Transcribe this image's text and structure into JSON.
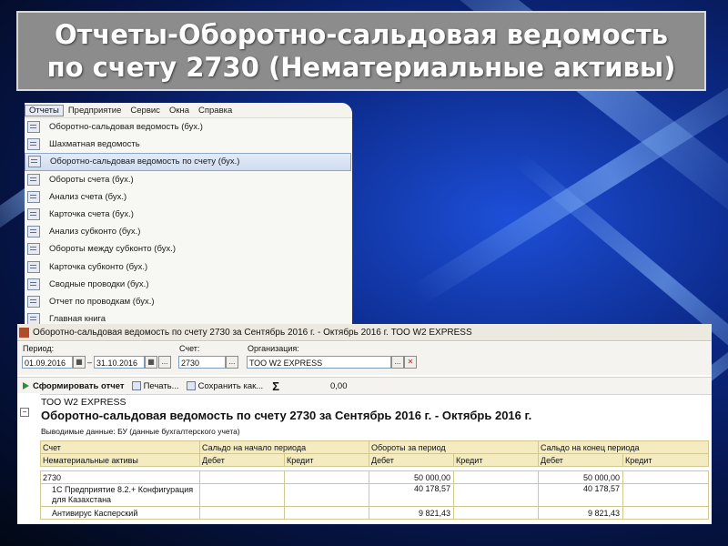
{
  "slide": {
    "title_line1": "Отчеты-Оборотно-сальдовая ведомость",
    "title_line2": "по счету 2730 (Нематериальные активы)"
  },
  "menu": {
    "bar": [
      "Отчеты",
      "Предприятие",
      "Сервис",
      "Окна",
      "Справка"
    ],
    "items": [
      {
        "label": "Оборотно-сальдовая ведомость (бух.)",
        "icon": "report-icon"
      },
      {
        "label": "Шахматная ведомость",
        "icon": "grid-report-icon"
      },
      {
        "label": "Оборотно-сальдовая ведомость по счету (бух.)",
        "icon": "report-icon",
        "selected": true
      },
      {
        "label": "Обороты счета (бух.)",
        "icon": "report-icon"
      },
      {
        "label": "Анализ счета (бух.)",
        "icon": "analysis-icon"
      },
      {
        "label": "Карточка счета (бух.)",
        "icon": "card-icon"
      },
      {
        "label": "Анализ субконто (бух.)",
        "icon": "analysis-icon"
      },
      {
        "label": "Обороты между субконто (бух.)",
        "icon": "report-icon"
      },
      {
        "label": "Карточка субконто (бух.)",
        "icon": "card-icon"
      },
      {
        "label": "Сводные проводки (бух.)",
        "icon": "report-icon"
      },
      {
        "label": "Отчет по проводкам (бух.)",
        "icon": "report-icon"
      },
      {
        "label": "Главная книга",
        "icon": "book-icon"
      }
    ]
  },
  "report": {
    "window_title": "Оборотно-сальдовая ведомость по счету 2730 за Сентябрь 2016 г. - Октябрь 2016 г. ТОО W2 EXPRESS",
    "period_label": "Период:",
    "date_from": "01.09.2016",
    "date_sep": "–",
    "date_to": "31.10.2016",
    "account_label": "Счет:",
    "account_value": "2730",
    "org_label": "Организация:",
    "org_value": "ТОО W2 EXPRESS",
    "ellipsis": "...",
    "clear": "✕",
    "toolbar": {
      "generate": "Сформировать отчет",
      "print": "Печать...",
      "save": "Сохранить как...",
      "sigma": "Σ",
      "sum": "0,00"
    },
    "doc": {
      "org": "ТОО W2 EXPRESS",
      "title": "Оборотно-сальдовая ведомость по счету 2730 за Сентябрь 2016 г. - Октябрь 2016 г.",
      "output": "Выводимые данные:  БУ (данные бухгалтерского учета)",
      "head1": [
        "Счет",
        "Сальдо на начало периода",
        "Обороты за период",
        "Сальдо на конец периода"
      ],
      "head2": [
        "Нематериальные активы",
        "Дебет",
        "Кредит",
        "Дебет",
        "Кредит",
        "Дебет",
        "Кредит"
      ],
      "rows": [
        [
          "2730",
          "",
          "",
          "50 000,00",
          "",
          "50 000,00",
          ""
        ],
        [
          "1С Предприятие 8.2.+ Конфигурация для Казахстана",
          "",
          "",
          "40 178,57",
          "",
          "40 178,57",
          ""
        ],
        [
          "Антивирус Касперский",
          "",
          "",
          "9 821,43",
          "",
          "9 821,43",
          ""
        ]
      ]
    }
  }
}
